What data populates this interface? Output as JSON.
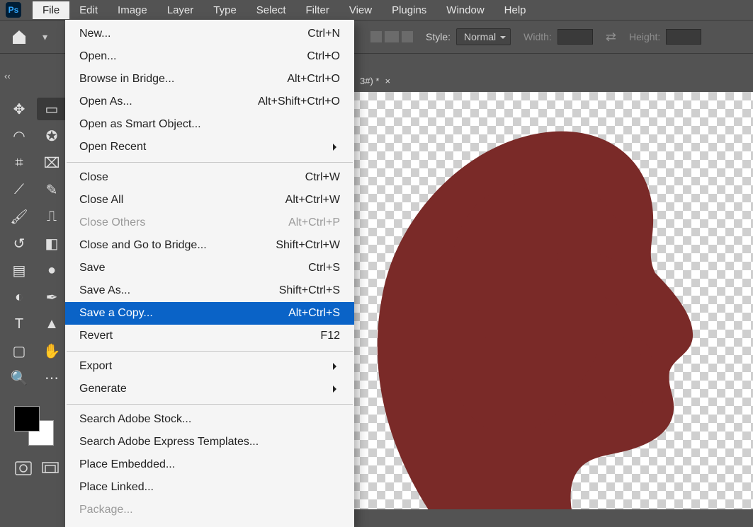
{
  "app": {
    "logo_text": "Ps"
  },
  "menu": {
    "items": [
      "File",
      "Edit",
      "Image",
      "Layer",
      "Type",
      "Select",
      "Filter",
      "View",
      "Plugins",
      "Window",
      "Help"
    ],
    "active_index": 0
  },
  "options_bar": {
    "style_label": "Style:",
    "style_value": "Normal",
    "width_label": "Width:",
    "height_label": "Height:"
  },
  "doc_tab": {
    "title_suffix": "3#) *",
    "close_glyph": "×"
  },
  "collapse_glyph": "‹‹",
  "file_menu": [
    {
      "label": "New...",
      "shortcut": "Ctrl+N"
    },
    {
      "label": "Open...",
      "shortcut": "Ctrl+O"
    },
    {
      "label": "Browse in Bridge...",
      "shortcut": "Alt+Ctrl+O"
    },
    {
      "label": "Open As...",
      "shortcut": "Alt+Shift+Ctrl+O"
    },
    {
      "label": "Open as Smart Object..."
    },
    {
      "label": "Open Recent",
      "arrow": true
    },
    {
      "sep": true
    },
    {
      "label": "Close",
      "shortcut": "Ctrl+W"
    },
    {
      "label": "Close All",
      "shortcut": "Alt+Ctrl+W"
    },
    {
      "label": "Close Others",
      "shortcut": "Alt+Ctrl+P",
      "disabled": true
    },
    {
      "label": "Close and Go to Bridge...",
      "shortcut": "Shift+Ctrl+W"
    },
    {
      "label": "Save",
      "shortcut": "Ctrl+S"
    },
    {
      "label": "Save As...",
      "shortcut": "Shift+Ctrl+S"
    },
    {
      "label": "Save a Copy...",
      "shortcut": "Alt+Ctrl+S",
      "selected": true
    },
    {
      "label": "Revert",
      "shortcut": "F12"
    },
    {
      "sep": true
    },
    {
      "label": "Export",
      "arrow": true
    },
    {
      "label": "Generate",
      "arrow": true
    },
    {
      "sep": true
    },
    {
      "label": "Search Adobe Stock..."
    },
    {
      "label": "Search Adobe Express Templates..."
    },
    {
      "label": "Place Embedded..."
    },
    {
      "label": "Place Linked..."
    },
    {
      "label": "Package...",
      "disabled": true
    }
  ],
  "tools": [
    "move-tool",
    "marquee-tool",
    "lasso-tool",
    "quick-select-tool",
    "crop-tool",
    "frame-tool",
    "eyedropper-tool",
    "healing-brush-tool",
    "brush-tool",
    "clone-stamp-tool",
    "history-brush-tool",
    "eraser-tool",
    "gradient-tool",
    "blur-tool",
    "dodge-tool",
    "pen-tool",
    "type-tool",
    "path-select-tool",
    "rectangle-tool",
    "hand-tool",
    "zoom-tool",
    "more-tools"
  ]
}
